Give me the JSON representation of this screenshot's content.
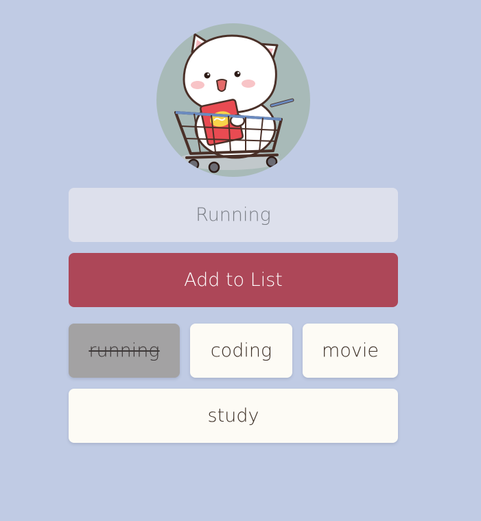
{
  "avatar": {
    "alt": "cat in shopping cart",
    "colors": {
      "circle": "#a8bab8",
      "cat": "#ffffff",
      "cart": "#6b8bbf",
      "bag": "#e94b52"
    }
  },
  "input": {
    "placeholder": "Running",
    "value": ""
  },
  "add_button": {
    "label": "Add to List",
    "color": "#ad4758"
  },
  "items": [
    {
      "label": "running",
      "done": true
    },
    {
      "label": "coding",
      "done": false
    },
    {
      "label": "movie",
      "done": false
    },
    {
      "label": "study",
      "done": false
    }
  ],
  "colors": {
    "background": "#c0cbe4",
    "item_bg": "#fdfbf5",
    "item_done_bg": "#a3a2a3"
  }
}
